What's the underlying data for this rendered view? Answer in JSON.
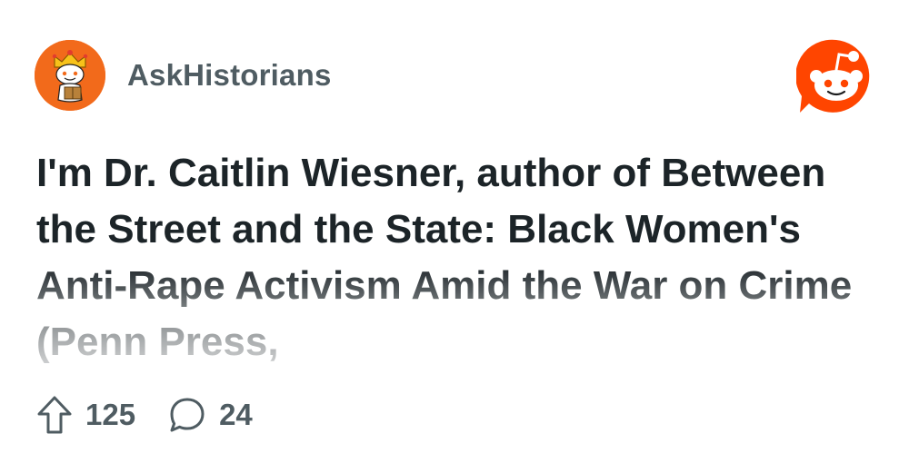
{
  "subreddit": {
    "name": "AskHistorians",
    "avatar_icon": "askhistorians-snoo-avatar",
    "avatar_color": "#f26a1b"
  },
  "brand": {
    "logo_icon": "reddit-logo-icon",
    "color": "#ff4500"
  },
  "post": {
    "title": "I'm Dr. Caitlin Wiesner, author of Between the Street and the State: Black Women's Anti-Rape Activism Amid the War on Crime (Penn Press,"
  },
  "stats": {
    "upvote_icon": "upvote-arrow-icon",
    "upvotes": "125",
    "comment_icon": "comment-bubble-icon",
    "comments": "24"
  },
  "colors": {
    "title": "#1c2428",
    "meta": "#4f5c62"
  }
}
